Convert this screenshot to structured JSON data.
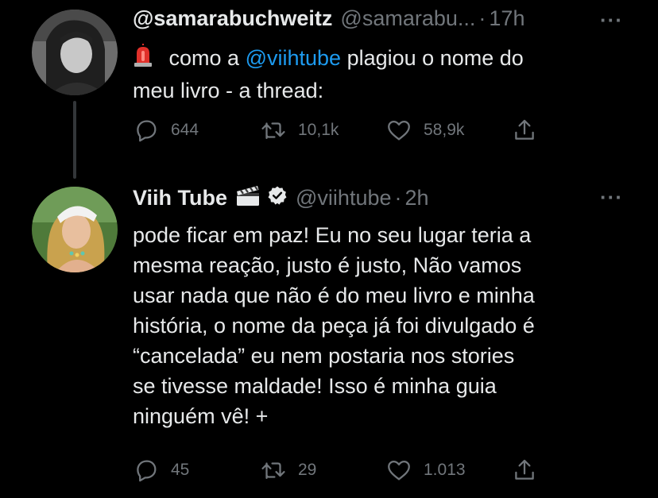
{
  "tweet1": {
    "display_name": "@samarabuchweitz",
    "handle": "@samarabu...",
    "separator": "·",
    "time": "17h",
    "more": "···",
    "emoji_icon": "police-light-icon",
    "text_before": "como a",
    "mention": "@viihtube",
    "text_after": "plagiou o nome do",
    "text_line2": "meu livro - a thread:",
    "replies": "644",
    "retweets": "10,1k",
    "likes": "58,9k"
  },
  "tweet2": {
    "display_name": "Viih Tube",
    "name_emoji_icon": "clapper-board-icon",
    "verified_icon": "verified-badge-icon",
    "handle": "@viihtube",
    "separator": "·",
    "time": "2h",
    "more": "···",
    "lines": [
      "pode ficar em paz! Eu no seu lugar teria a",
      "mesma reação, justo é justo, Não vamos",
      "usar nada que não é do meu livro e minha",
      "história, o nome da peça já foi divulgado é",
      "“cancelada” eu nem postaria nos stories",
      "se tivesse maldade! Isso é minha guia",
      "ninguém vê! +"
    ],
    "replies": "45",
    "retweets": "29",
    "likes": "1.013"
  },
  "colors": {
    "background": "#000000",
    "text": "#e7e9ea",
    "muted": "#71767b",
    "mention": "#1d9bf0"
  }
}
